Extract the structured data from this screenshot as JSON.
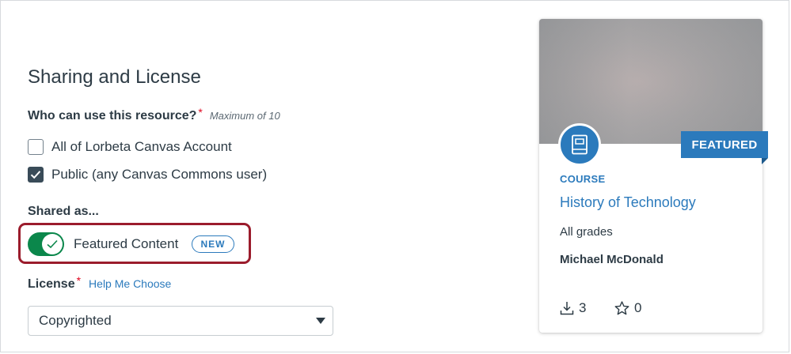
{
  "form": {
    "section_title": "Sharing and License",
    "who_label": "Who can use this resource?",
    "required_mark": "*",
    "max_note": "Maximum of 10",
    "options": [
      {
        "label": "All of Lorbeta Canvas Account",
        "checked": false
      },
      {
        "label": "Public (any Canvas Commons user)",
        "checked": true
      }
    ],
    "shared_as_label": "Shared as...",
    "featured_toggle": {
      "label": "Featured Content",
      "on": true,
      "badge": "NEW"
    },
    "license_label": "License",
    "help_link": "Help Me Choose",
    "license_value": "Copyrighted"
  },
  "card": {
    "ribbon": "FEATURED",
    "type": "COURSE",
    "title": "History of Technology",
    "grades": "All grades",
    "author": "Michael  McDonald",
    "downloads": "3",
    "favorites": "0"
  },
  "colors": {
    "accent": "#2b7abc",
    "toggle_on": "#0b874b",
    "highlight": "#9b1c2c",
    "required": "#e0061f",
    "text": "#2d3b45"
  }
}
